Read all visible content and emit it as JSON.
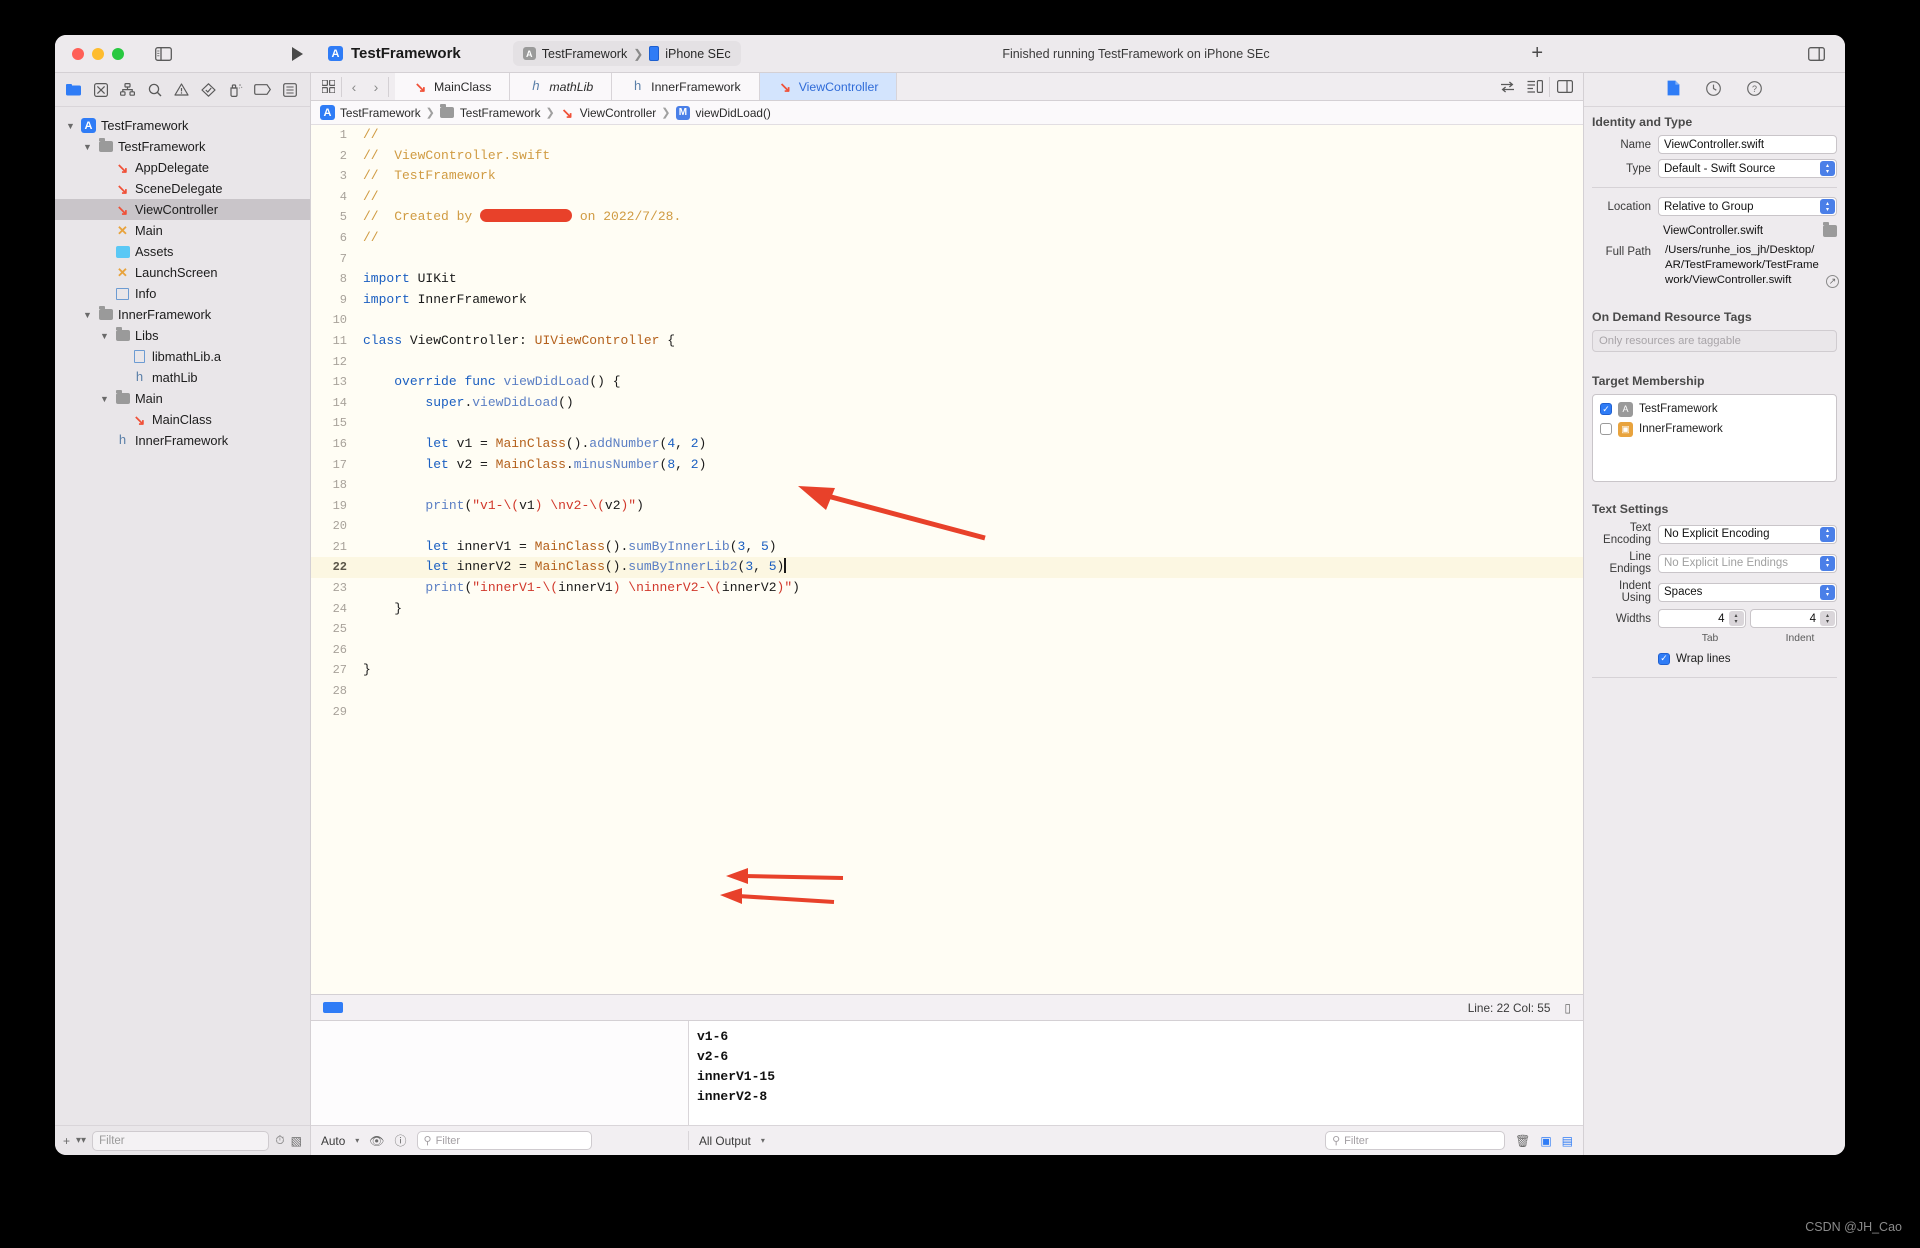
{
  "window": {
    "title": "TestFramework",
    "scheme": "TestFramework",
    "destination": "iPhone SEc",
    "status": "Finished running TestFramework on iPhone SEc"
  },
  "navigator": {
    "tree": [
      {
        "label": "TestFramework",
        "icon": "app-store-icon",
        "depth": 0,
        "disc": "v",
        "selected": false
      },
      {
        "label": "TestFramework",
        "icon": "folder-icon",
        "depth": 1,
        "disc": "v",
        "selected": false
      },
      {
        "label": "AppDelegate",
        "icon": "swift-icon",
        "depth": 2,
        "disc": "",
        "selected": false
      },
      {
        "label": "SceneDelegate",
        "icon": "swift-icon",
        "depth": 2,
        "disc": "",
        "selected": false
      },
      {
        "label": "ViewController",
        "icon": "swift-icon",
        "depth": 2,
        "disc": "",
        "selected": true
      },
      {
        "label": "Main",
        "icon": "storyboard-icon",
        "depth": 2,
        "disc": "",
        "selected": false
      },
      {
        "label": "Assets",
        "icon": "assets-icon",
        "depth": 2,
        "disc": "",
        "selected": false
      },
      {
        "label": "LaunchScreen",
        "icon": "storyboard-icon",
        "depth": 2,
        "disc": "",
        "selected": false
      },
      {
        "label": "Info",
        "icon": "plist-icon",
        "depth": 2,
        "disc": "",
        "selected": false
      },
      {
        "label": "InnerFramework",
        "icon": "folder-icon",
        "depth": 1,
        "disc": "v",
        "selected": false
      },
      {
        "label": "Libs",
        "icon": "folder-icon",
        "depth": 2,
        "disc": "v",
        "selected": false
      },
      {
        "label": "libmathLib.a",
        "icon": "file-icon",
        "depth": 3,
        "disc": "",
        "selected": false
      },
      {
        "label": "mathLib",
        "icon": "header-icon",
        "depth": 3,
        "disc": "",
        "selected": false
      },
      {
        "label": "Main",
        "icon": "folder-icon",
        "depth": 2,
        "disc": "v",
        "selected": false
      },
      {
        "label": "MainClass",
        "icon": "swift-icon",
        "depth": 3,
        "disc": "",
        "selected": false
      },
      {
        "label": "InnerFramework",
        "icon": "header-icon",
        "depth": 2,
        "disc": "",
        "selected": false
      }
    ],
    "filter_placeholder": "Filter"
  },
  "editor": {
    "tabs": [
      {
        "label": "MainClass",
        "icon": "swift-icon",
        "active": false,
        "italic": false
      },
      {
        "label": "mathLib",
        "icon": "header-icon",
        "active": false,
        "italic": true
      },
      {
        "label": "InnerFramework",
        "icon": "header-icon",
        "active": false,
        "italic": false
      },
      {
        "label": "ViewController",
        "icon": "swift-icon",
        "active": true,
        "italic": false
      }
    ],
    "breadcrumb": [
      {
        "label": "TestFramework",
        "icon": "app-store-icon"
      },
      {
        "label": "TestFramework",
        "icon": "folder-icon"
      },
      {
        "label": "ViewController",
        "icon": "swift-icon"
      },
      {
        "label": "viewDidLoad()",
        "icon": "method-icon"
      }
    ],
    "status": {
      "line_col": "Line: 22  Col: 55"
    },
    "code_lines": [
      {
        "n": 1,
        "html": "<span class='c-cmt'>//</span>"
      },
      {
        "n": 2,
        "html": "<span class='c-cmt'>//  ViewController.swift</span>"
      },
      {
        "n": 3,
        "html": "<span class='c-cmt'>//  TestFramework</span>"
      },
      {
        "n": 4,
        "html": "<span class='c-cmt'>//</span>"
      },
      {
        "n": 5,
        "html": "<span class='c-cmt'>//  Created by </span><span class='redact'></span><span class='c-cmt'> on 2022/7/28.</span>"
      },
      {
        "n": 6,
        "html": "<span class='c-cmt'>//</span>"
      },
      {
        "n": 7,
        "html": ""
      },
      {
        "n": 8,
        "html": "<span class='c-kw'>import</span> <span class='c-pln'>UIKit</span>"
      },
      {
        "n": 9,
        "html": "<span class='c-kw'>import</span> <span class='c-pln'>InnerFramework</span>"
      },
      {
        "n": 10,
        "html": ""
      },
      {
        "n": 11,
        "html": "<span class='c-kw'>class</span> <span class='c-pln'>ViewController</span><span class='c-pln'>: </span><span class='c-type'>UIViewController</span> <span class='c-pln'>{</span>"
      },
      {
        "n": 12,
        "html": ""
      },
      {
        "n": 13,
        "html": "    <span class='c-kw'>override</span> <span class='c-kw'>func</span> <span class='c-meth'>viewDidLoad</span><span class='c-pln'>() {</span>"
      },
      {
        "n": 14,
        "html": "        <span class='c-kw'>super</span><span class='c-pln'>.</span><span class='c-meth'>viewDidLoad</span><span class='c-pln'>()</span>"
      },
      {
        "n": 15,
        "html": ""
      },
      {
        "n": 16,
        "html": "        <span class='c-kw'>let</span> <span class='c-pln'>v1 = </span><span class='c-type'>MainClass</span><span class='c-pln'>().</span><span class='c-meth'>addNumber</span><span class='c-pln'>(</span><span class='c-num'>4</span><span class='c-pln'>, </span><span class='c-num'>2</span><span class='c-pln'>)</span>"
      },
      {
        "n": 17,
        "html": "        <span class='c-kw'>let</span> <span class='c-pln'>v2 = </span><span class='c-type'>MainClass</span><span class='c-pln'>.</span><span class='c-meth'>minusNumber</span><span class='c-pln'>(</span><span class='c-num'>8</span><span class='c-pln'>, </span><span class='c-num'>2</span><span class='c-pln'>)</span>"
      },
      {
        "n": 18,
        "html": ""
      },
      {
        "n": 19,
        "html": "        <span class='c-meth'>print</span><span class='c-pln'>(</span><span class='c-str'>\"v1-\\(</span><span class='c-pln'>v1</span><span class='c-str'>) \\nv2-\\(</span><span class='c-pln'>v2</span><span class='c-str'>)\"</span><span class='c-pln'>)</span>"
      },
      {
        "n": 20,
        "html": ""
      },
      {
        "n": 21,
        "html": "        <span class='c-kw'>let</span> <span class='c-pln'>innerV1 = </span><span class='c-type'>MainClass</span><span class='c-pln'>().</span><span class='c-meth'>sumByInnerLib</span><span class='c-pln'>(</span><span class='c-num'>3</span><span class='c-pln'>, </span><span class='c-num'>5</span><span class='c-pln'>)</span>"
      },
      {
        "n": 22,
        "html": "        <span class='c-kw'>let</span> <span class='c-pln'>innerV2 = </span><span class='c-type'>MainClass</span><span class='c-pln'>().</span><span class='c-meth'>sumByInnerLib2</span><span class='c-pln'>(</span><span class='c-num'>3</span><span class='c-pln'>, </span><span class='c-num'>5</span><span class='c-pln'>)</span><span class='caret'></span>",
        "highlight": true
      },
      {
        "n": 23,
        "html": "        <span class='c-meth'>print</span><span class='c-pln'>(</span><span class='c-str'>\"innerV1-\\(</span><span class='c-pln'>innerV1</span><span class='c-str'>) \\ninnerV2-\\(</span><span class='c-pln'>innerV2</span><span class='c-str'>)\"</span><span class='c-pln'>)</span>"
      },
      {
        "n": 24,
        "html": "    <span class='c-pln'>}</span>"
      },
      {
        "n": 25,
        "html": ""
      },
      {
        "n": 26,
        "html": ""
      },
      {
        "n": 27,
        "html": "<span class='c-pln'>}</span>"
      },
      {
        "n": 28,
        "html": ""
      },
      {
        "n": 29,
        "html": ""
      }
    ]
  },
  "debug": {
    "console_lines": [
      "v1-6",
      "v2-6",
      "innerV1-15",
      "innerV2-8"
    ],
    "auto_label": "Auto",
    "output_label": "All Output",
    "vars_filter_placeholder": "Filter",
    "console_filter_placeholder": "Filter"
  },
  "inspector": {
    "tabs": [
      "file-inspector-icon",
      "history-inspector-icon",
      "quick-help-icon"
    ],
    "identity": {
      "section": "Identity and Type",
      "name_label": "Name",
      "name_value": "ViewController.swift",
      "type_label": "Type",
      "type_value": "Default - Swift Source",
      "location_label": "Location",
      "location_value": "Relative to Group",
      "location_file": "ViewController.swift",
      "fullpath_label": "Full Path",
      "fullpath_value": "/Users/runhe_ios_jh/Desktop/AR/TestFramework/TestFramework/ViewController.swift"
    },
    "odrt": {
      "section": "On Demand Resource Tags",
      "placeholder": "Only resources are taggable"
    },
    "target_membership": {
      "section": "Target Membership",
      "items": [
        {
          "label": "TestFramework",
          "checked": true
        },
        {
          "label": "InnerFramework",
          "checked": false
        }
      ]
    },
    "text_settings": {
      "section": "Text Settings",
      "encoding_label": "Text Encoding",
      "encoding_value": "No Explicit Encoding",
      "endings_label": "Line Endings",
      "endings_value": "No Explicit Line Endings",
      "indent_label": "Indent Using",
      "indent_value": "Spaces",
      "widths_label": "Widths",
      "tab_value": "4",
      "indent_value_num": "4",
      "tab_sublabel": "Tab",
      "indent_sublabel": "Indent",
      "wrap_label": "Wrap lines",
      "wrap_checked": true
    }
  },
  "watermark": "CSDN @JH_Cao",
  "colors": {
    "accent": "#2F7CF6",
    "swift_orange": "#F05138",
    "arrow_red": "#E8412A",
    "editor_bg": "#FFFDF4"
  }
}
